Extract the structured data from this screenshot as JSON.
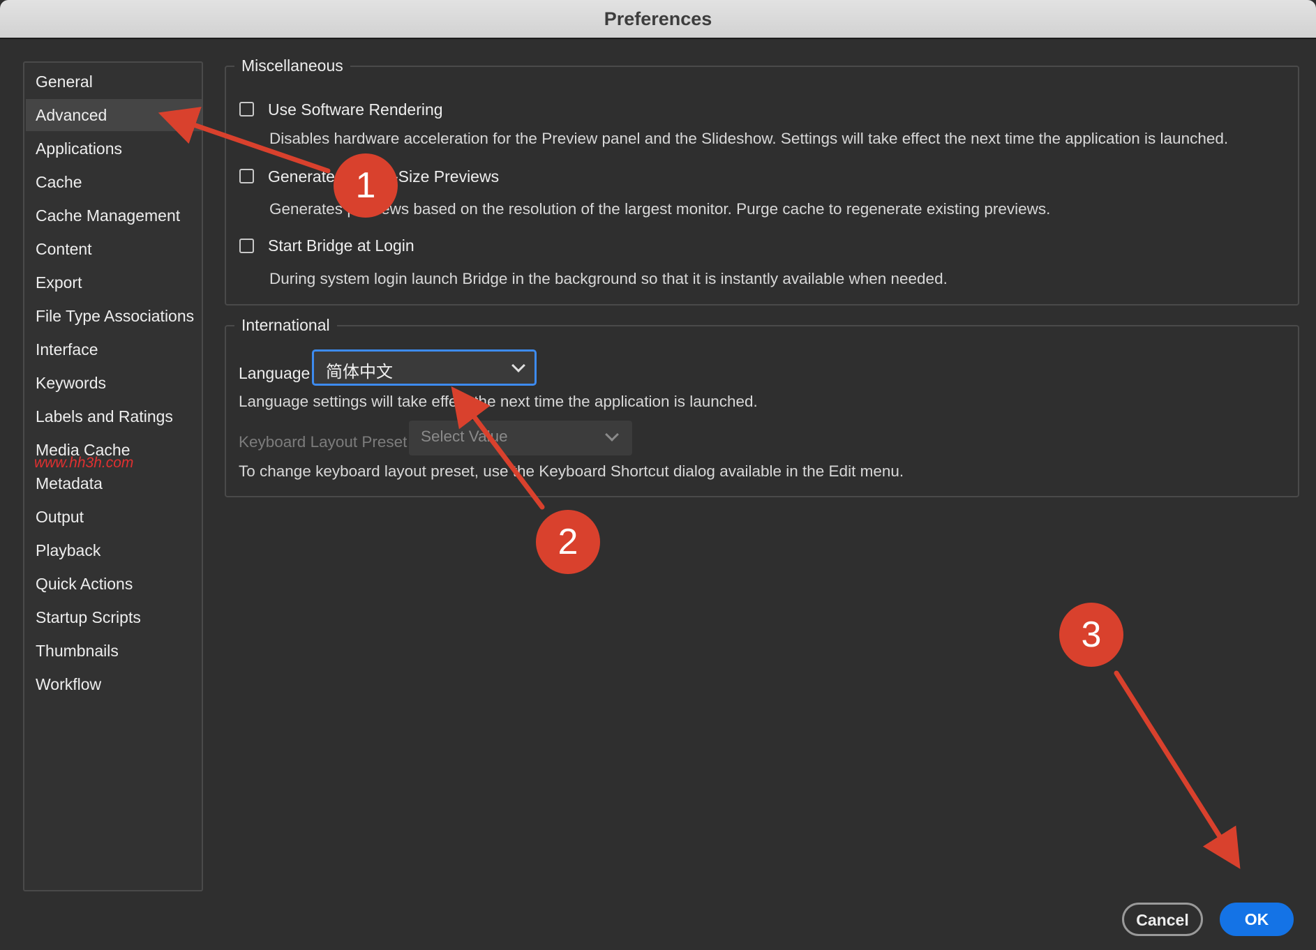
{
  "window": {
    "title": "Preferences"
  },
  "sidebar": {
    "items": [
      {
        "label": "General",
        "active": false
      },
      {
        "label": "Advanced",
        "active": true
      },
      {
        "label": "Applications",
        "active": false
      },
      {
        "label": "Cache",
        "active": false
      },
      {
        "label": "Cache Management",
        "active": false
      },
      {
        "label": "Content",
        "active": false
      },
      {
        "label": "Export",
        "active": false
      },
      {
        "label": "File Type Associations",
        "active": false
      },
      {
        "label": "Interface",
        "active": false
      },
      {
        "label": "Keywords",
        "active": false
      },
      {
        "label": "Labels and Ratings",
        "active": false
      },
      {
        "label": "Media Cache",
        "active": false
      },
      {
        "label": "Metadata",
        "active": false
      },
      {
        "label": "Output",
        "active": false
      },
      {
        "label": "Playback",
        "active": false
      },
      {
        "label": "Quick Actions",
        "active": false
      },
      {
        "label": "Startup Scripts",
        "active": false
      },
      {
        "label": "Thumbnails",
        "active": false
      },
      {
        "label": "Workflow",
        "active": false
      }
    ]
  },
  "watermark": "www.hh3h.com",
  "misc": {
    "title": "Miscellaneous",
    "software_rendering": {
      "label": "Use Software Rendering",
      "checked": false,
      "desc": "Disables hardware acceleration for the Preview panel and the Slideshow. Settings will take effect the next time the application is launched."
    },
    "monitor_previews": {
      "label": "Generate Monitor-Size Previews",
      "checked": false,
      "desc": "Generates previews based on the resolution of the largest monitor.  Purge cache to regenerate existing previews."
    },
    "start_at_login": {
      "label": "Start Bridge at Login",
      "checked": false,
      "desc": "During system login launch Bridge in the background so that it is instantly available when needed."
    }
  },
  "international": {
    "title": "International",
    "language_label": "Language",
    "language_value": "简体中文",
    "language_note": "Language settings will take effect the next time the application is launched.",
    "keyboard_label": "Keyboard Layout Preset",
    "keyboard_placeholder": "Select Value",
    "keyboard_note": "To change keyboard layout preset, use the Keyboard Shortcut dialog available in the Edit menu."
  },
  "buttons": {
    "cancel": "Cancel",
    "ok": "OK"
  },
  "annotations": {
    "badge1": "1",
    "badge2": "2",
    "badge3": "3",
    "color": "#d9412d"
  },
  "colors": {
    "accent": "#1473e6",
    "focus": "#3d8bf0",
    "background": "#2f2f2f"
  }
}
